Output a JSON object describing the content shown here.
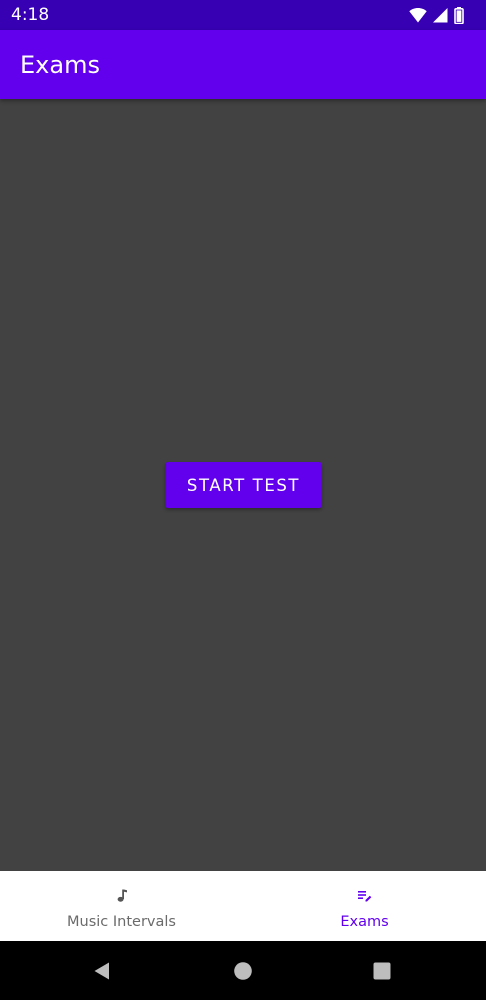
{
  "status_bar": {
    "time": "4:18",
    "icons": [
      "wifi-icon",
      "cellular-signal-icon",
      "battery-icon"
    ]
  },
  "app_bar": {
    "title": "Exams"
  },
  "main": {
    "start_button_label": "START TEST"
  },
  "bottom_nav": {
    "items": [
      {
        "label": "Music Intervals",
        "icon": "music-note-icon",
        "active": false
      },
      {
        "label": "Exams",
        "icon": "playlist-edit-icon",
        "active": true
      }
    ]
  },
  "system_nav": {
    "buttons": [
      "back-icon",
      "home-icon",
      "recents-icon"
    ]
  },
  "colors": {
    "status_bar": "#3700B3",
    "primary": "#6200EE",
    "background": "#424242",
    "nav_background": "#FFFFFF",
    "nav_inactive": "#6B6B6B"
  }
}
